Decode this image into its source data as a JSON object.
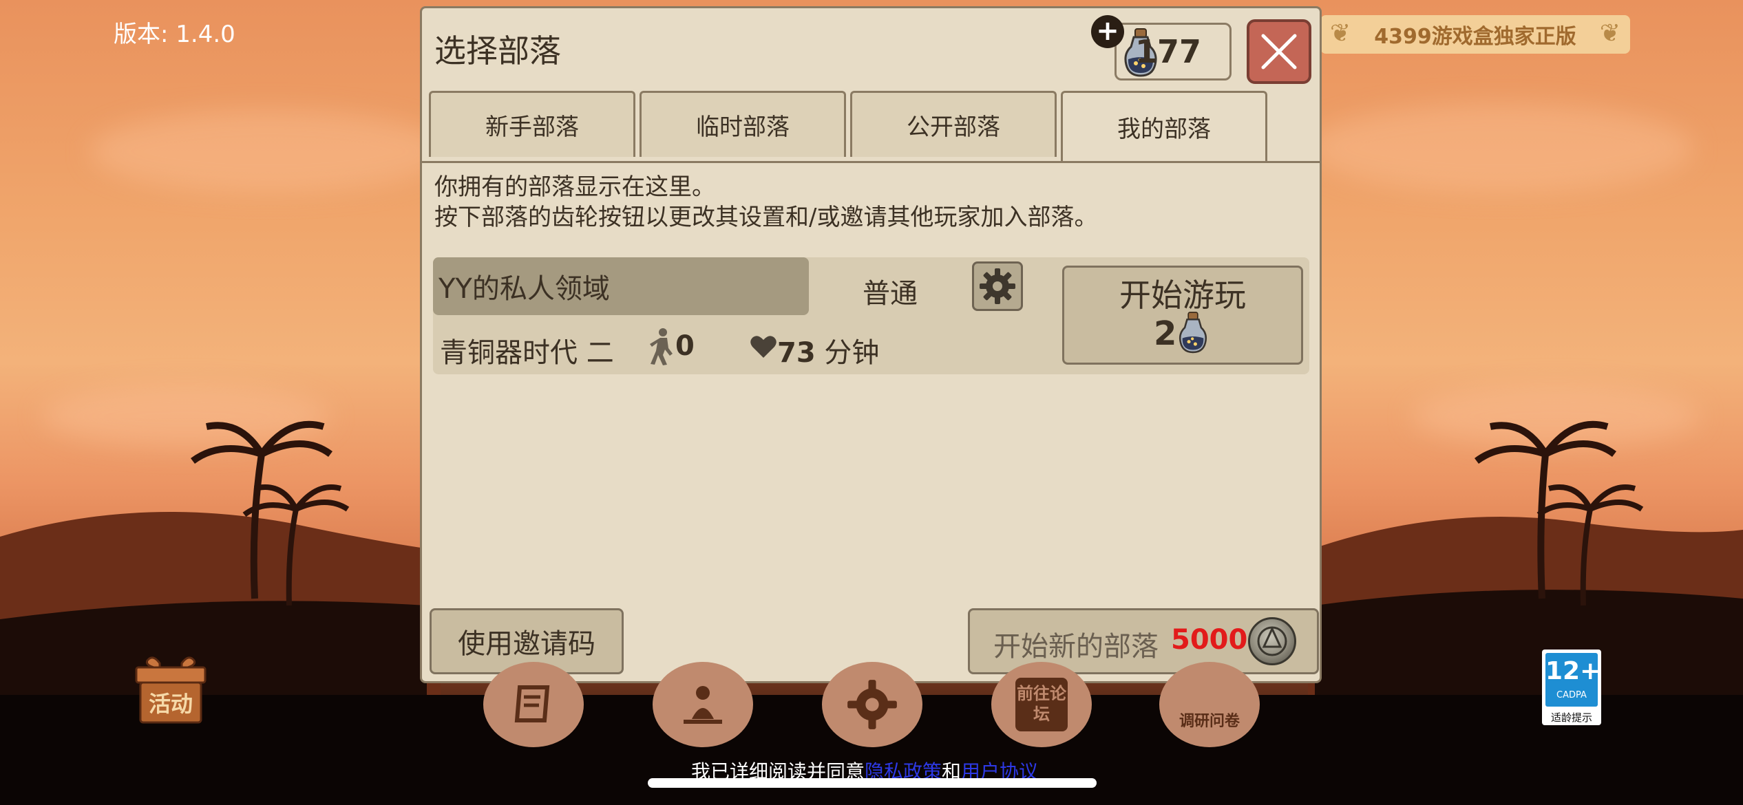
{
  "version_text": "版本: 1.4.0",
  "badge_4399": "4399游戏盒独家正版",
  "dialog": {
    "title": "选择部落",
    "gem_count": "177",
    "tabs": [
      {
        "label": "新手部落",
        "active": false
      },
      {
        "label": "临时部落",
        "active": false
      },
      {
        "label": "公开部落",
        "active": false
      },
      {
        "label": "我的部落",
        "active": true
      }
    ],
    "description_line1": "你拥有的部落显示在这里。",
    "description_line2": "按下部落的齿轮按钮以更改其设置和/或邀请其他玩家加入部落。",
    "tribe": {
      "name": "YY的私人领域",
      "difficulty": "普通",
      "era": "青铜器时代 二",
      "players": "0",
      "time_value": "73",
      "time_unit": "分钟",
      "play_label": "开始游玩",
      "play_cost": "2"
    },
    "invite_button": "使用邀请码",
    "new_tribe_label": "开始新的部落",
    "new_tribe_cost": "5000"
  },
  "bottom_menu": {
    "gift_label": "活动",
    "icons": [
      "scroll-icon",
      "meditation-icon",
      "settings-gear-icon",
      "forum-icon",
      "survey-icon"
    ],
    "forum_text": "前往论坛",
    "survey_text": "调研问卷"
  },
  "age_rating": {
    "number": "12+",
    "org": "CADPA",
    "label": "适龄提示"
  },
  "agreement": {
    "prefix": "我已详细阅读并同意",
    "privacy_link": "隐私政策",
    "and": "和",
    "user_link": "用户协议"
  },
  "colors": {
    "panel_bg": "#e7dcc6",
    "accent_red": "#e21b1b",
    "close_button": "#c46656",
    "link_blue": "#2d39e6"
  }
}
